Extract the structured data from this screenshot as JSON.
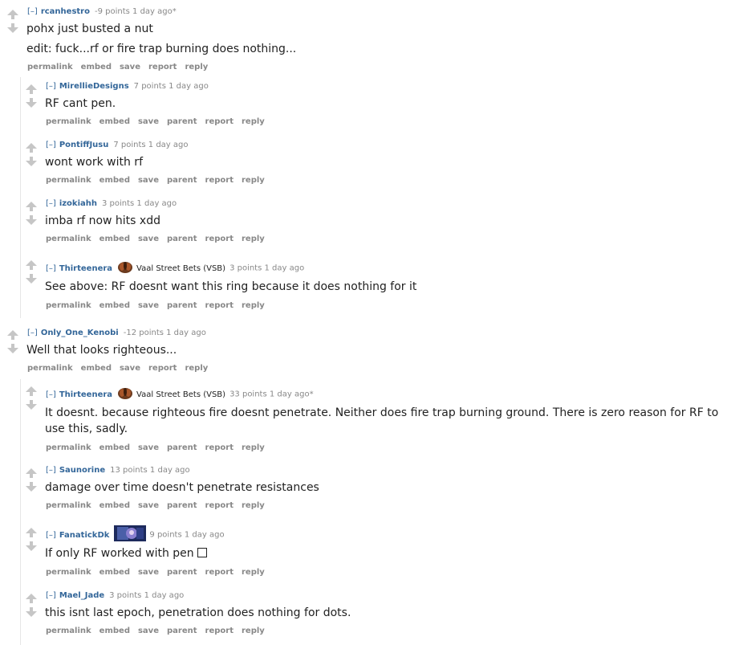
{
  "actions": {
    "permalink": "permalink",
    "embed": "embed",
    "save": "save",
    "parent": "parent",
    "report": "report",
    "reply": "reply"
  },
  "toggle": "[–]",
  "comments": [
    {
      "author": "rcanhestro",
      "score": "-9 points 1 day ago*",
      "body": [
        "pohx just busted a nut",
        "edit: fuck...rf or fire trap burning does nothing..."
      ]
    },
    {
      "author": "MirellieDesigns",
      "score": "7 points 1 day ago",
      "body": [
        "RF cant pen."
      ]
    },
    {
      "author": "PontiffJusu",
      "score": "7 points 1 day ago",
      "body": [
        "wont work with rf"
      ]
    },
    {
      "author": "izokiahh",
      "score": "3 points 1 day ago",
      "body": [
        "imba rf now hits xdd"
      ]
    },
    {
      "author": "Thirteenera",
      "flair": "Vaal Street Bets (VSB)",
      "flair_icon": "vaal-orb-icon",
      "score": "3 points 1 day ago",
      "body": [
        "See above: RF doesnt want this ring because it does nothing for it"
      ]
    },
    {
      "author": "Only_One_Kenobi",
      "score": "-12 points 1 day ago",
      "body": [
        "Well that looks righteous..."
      ]
    },
    {
      "author": "Thirteenera",
      "flair": "Vaal Street Bets (VSB)",
      "flair_icon": "vaal-orb-icon",
      "score": "33 points 1 day ago*",
      "body": [
        "It doesnt. because righteous fire doesnt penetrate. Neither does fire trap burning ground. There is zero reason for RF to use this, sadly."
      ]
    },
    {
      "author": "Saunorine",
      "score": "13 points 1 day ago",
      "body": [
        "damage over time doesn't penetrate resistances"
      ]
    },
    {
      "author": "FanatickDk",
      "flair_icon": "avatar-portrait-icon",
      "score": "9 points 1 day ago",
      "body": [
        "If only RF worked with pen"
      ]
    },
    {
      "author": "Mael_Jade",
      "score": "3 points 1 day ago",
      "body": [
        "this isnt last epoch, penetration does nothing for dots."
      ]
    }
  ]
}
